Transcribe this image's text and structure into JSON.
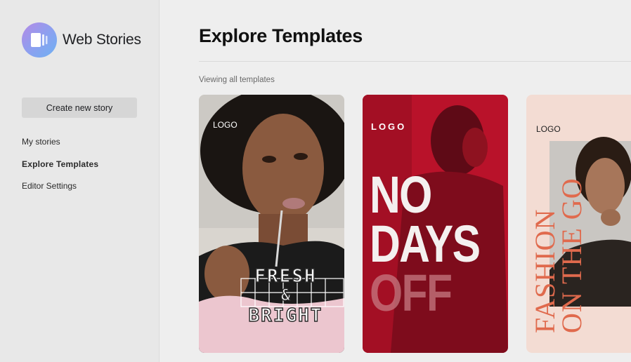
{
  "sidebar": {
    "brand": "Web Stories",
    "create_button": "Create new story",
    "nav": [
      {
        "label": "My stories"
      },
      {
        "label": "Explore Templates"
      },
      {
        "label": "Editor Settings"
      }
    ]
  },
  "main": {
    "title": "Explore Templates",
    "subtitle": "Viewing all templates"
  },
  "templates": [
    {
      "logo": "LOGO",
      "line1": "FRESH",
      "line2": "&",
      "line3": "BRIGHT"
    },
    {
      "logo": "LOGO",
      "line1": "NO",
      "line2": "DAYS",
      "line3": "OFF"
    },
    {
      "logo": "LOGO",
      "line1": "FASHION",
      "line2": "ON THE GO"
    }
  ],
  "colors": {
    "accent_gradient_start": "#b48ae6",
    "accent_gradient_end": "#6fb1f2",
    "card2_red": "#c3142c",
    "card3_peach": "#f3dcd3",
    "card3_text": "#e06a4d"
  }
}
